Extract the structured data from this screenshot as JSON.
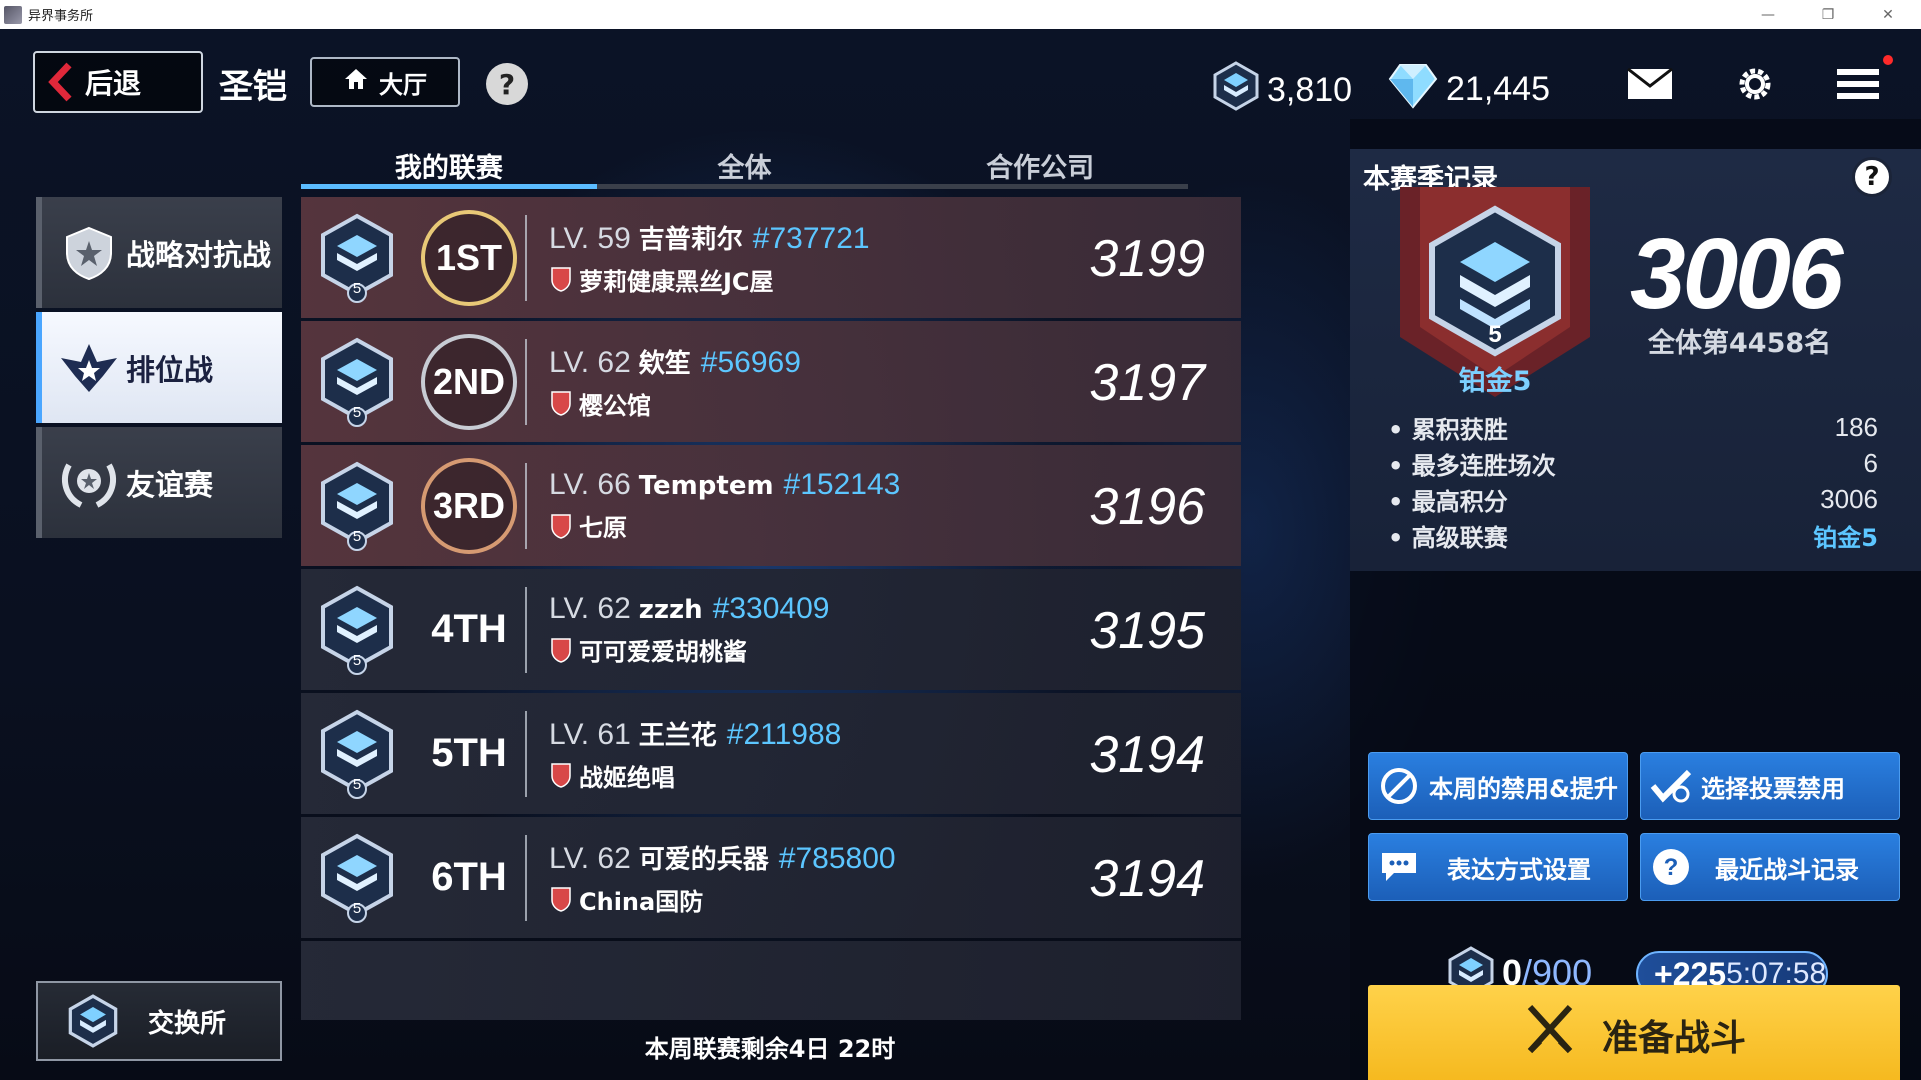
{
  "window": {
    "title": "异界事务所"
  },
  "header": {
    "back_label": "后退",
    "page_title": "圣铠",
    "lobby_label": "大厅",
    "help_label": "?",
    "currency1": "3,810",
    "currency2": "21,445"
  },
  "tabs": [
    "我的联赛",
    "全体",
    "合作公司"
  ],
  "left_menu": {
    "items": [
      {
        "label": "战略对抗战"
      },
      {
        "label": "排位战"
      },
      {
        "label": "友谊赛"
      }
    ],
    "exchange_label": "交换所"
  },
  "week_remaining": "本周联赛剩余4日  22时",
  "ranking": [
    {
      "tier": "5",
      "position": "1ST",
      "level": "LV. 59",
      "name": "吉普莉尔",
      "uid": "#737721",
      "guild": "萝莉健康黑丝JC屋",
      "score": "3199"
    },
    {
      "tier": "5",
      "position": "2ND",
      "level": "LV. 62",
      "name": "欸笙",
      "uid": "#56969",
      "guild": "樱公馆",
      "score": "3197"
    },
    {
      "tier": "5",
      "position": "3RD",
      "level": "LV. 66",
      "name": "Temptem",
      "uid": "#152143",
      "guild": "七原",
      "score": "3196"
    },
    {
      "tier": "5",
      "position": "4TH",
      "level": "LV. 62",
      "name": "zzzh",
      "uid": "#330409",
      "guild": "可可爱爱胡桃酱",
      "score": "3195"
    },
    {
      "tier": "5",
      "position": "5TH",
      "level": "LV. 61",
      "name": "王兰花",
      "uid": "#211988",
      "guild": "战姬绝唱",
      "score": "3194"
    },
    {
      "tier": "5",
      "position": "6TH",
      "level": "LV. 62",
      "name": "可爱的兵器",
      "uid": "#785800",
      "guild": "China国防",
      "score": "3194"
    }
  ],
  "season": {
    "title": "本赛季记录",
    "help": "?",
    "tier_num": "5",
    "tier_name": "铂金5",
    "score": "3006",
    "overall_rank": "全体第4458名",
    "stats": [
      {
        "label": "累积获胜",
        "value": "186"
      },
      {
        "label": "最多连胜场次",
        "value": "6"
      },
      {
        "label": "最高积分",
        "value": "3006"
      },
      {
        "label": "高级联赛",
        "value": "铂金5"
      }
    ]
  },
  "actions": {
    "ban_boost": "本周的禁用&提升",
    "vote_ban": "选择投票禁用",
    "expression": "表达方式设置",
    "recent": "最近战斗记录"
  },
  "points": {
    "current": "0",
    "max": "/900",
    "plus": "+225",
    "timer": "5:07:58"
  },
  "battle_label": "准备战斗",
  "colors": {
    "accent_blue": "#5cc6ff",
    "battle_yellow": "#f5b81d",
    "back_red": "#e0283a"
  }
}
